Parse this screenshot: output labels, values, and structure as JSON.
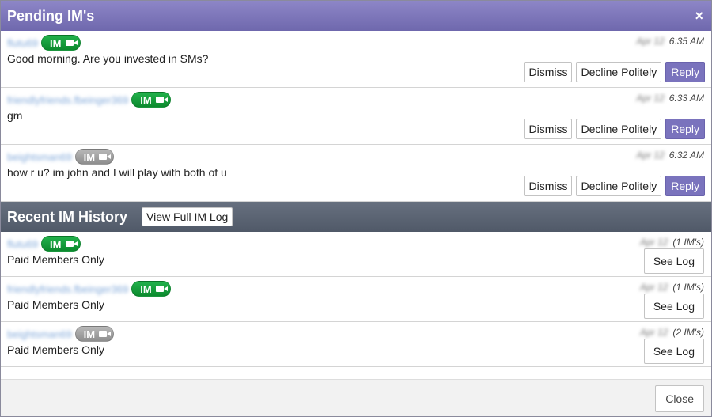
{
  "dialog": {
    "title": "Pending IM's",
    "close_icon": "×",
    "close_label": "Close"
  },
  "pending": {
    "actions": {
      "dismiss": "Dismiss",
      "decline": "Decline Politely",
      "reply": "Reply"
    },
    "items": [
      {
        "username": "flutu69",
        "status": "online",
        "badge": "IM",
        "date": "Apr 12",
        "time": "6:35 AM",
        "message": "Good morning. Are you invested in SMs?"
      },
      {
        "username": "friendlyfriends.fbeinger369",
        "status": "online",
        "badge": "IM",
        "date": "Apr 12",
        "time": "6:33 AM",
        "message": "gm"
      },
      {
        "username": "beightsman69",
        "status": "offline",
        "badge": "IM",
        "date": "Apr 12",
        "time": "6:32 AM",
        "message": "how r u? im john and I will play with both of u"
      }
    ]
  },
  "history": {
    "title": "Recent IM History",
    "view_full_log": "View Full IM Log",
    "see_log": "See Log",
    "items": [
      {
        "username": "flutu69",
        "status": "online",
        "badge": "IM",
        "date": "Apr 12",
        "count": "(1 IM's)",
        "message": "Paid Members Only"
      },
      {
        "username": "friendlyfriends.fbeinger369",
        "status": "online",
        "badge": "IM",
        "date": "Apr 12",
        "count": "(1 IM's)",
        "message": "Paid Members Only"
      },
      {
        "username": "beightsman69",
        "status": "offline",
        "badge": "IM",
        "date": "Apr 12",
        "count": "(2 IM's)",
        "message": "Paid Members Only"
      }
    ]
  },
  "colors": {
    "titlebar": "#7a73bd",
    "reply_button": "#7a73bd",
    "online_badge": "#1aa63f",
    "offline_badge": "#a0a0a0",
    "section_header": "#5a6372"
  }
}
